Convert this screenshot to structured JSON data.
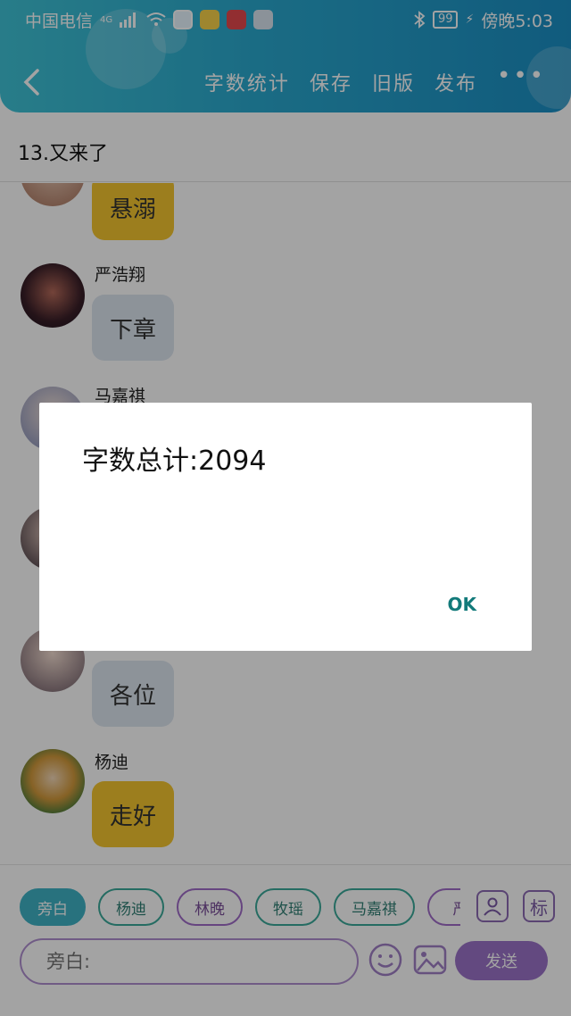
{
  "status_bar": {
    "carrier": "中国电信",
    "network": "4G",
    "battery": "99",
    "time": "傍晚5:03"
  },
  "nav": {
    "actions": [
      "字数统计",
      "保存",
      "旧版",
      "发布"
    ],
    "more": "•••"
  },
  "chapter_title": "13.又来了",
  "messages": [
    {
      "sender": "",
      "text": "悬溺",
      "style": "gold"
    },
    {
      "sender": "严浩翔",
      "text": "下章",
      "style": "grey"
    },
    {
      "sender": "马嘉祺",
      "text": "",
      "style": "grey"
    },
    {
      "sender": "",
      "text": "各位",
      "style": "grey"
    },
    {
      "sender": "杨迪",
      "text": "走好",
      "style": "gold"
    }
  ],
  "dialog": {
    "message": "字数总计:2094",
    "ok": "OK"
  },
  "chips": [
    "旁白",
    "杨迪",
    "林晚",
    "牧瑶",
    "马嘉祺",
    "严"
  ],
  "icons": {
    "avatar_button": "person-icon",
    "tag_button": "标"
  },
  "input": {
    "placeholder": "旁白:"
  },
  "send_label": "发送",
  "colors": {
    "header": "#2aa9cf",
    "gold_bubble": "#f4c630",
    "grey_bubble": "#dde6ef",
    "accent_purple": "#9b72c8",
    "ok": "#127a7a"
  }
}
